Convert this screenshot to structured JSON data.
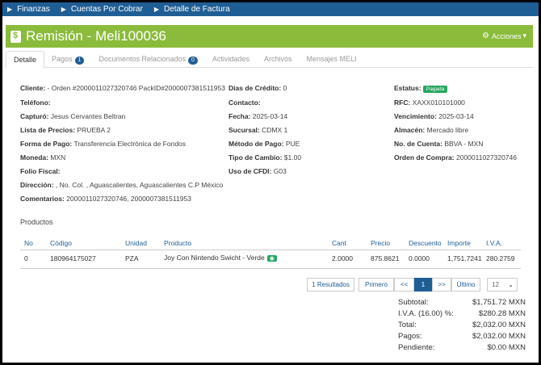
{
  "breadcrumbs": [
    "Finanzas",
    "Cuentas Por Cobrar",
    "Detalle de Factura"
  ],
  "header": {
    "title": "Remisión - Meli100036",
    "actions_label": "Acciones"
  },
  "tabs": [
    {
      "label": "Detalle",
      "badge": ""
    },
    {
      "label": "Pagos",
      "badge": "1"
    },
    {
      "label": "Documentos Relacionados",
      "badge": "0"
    },
    {
      "label": "Actividades",
      "badge": ""
    },
    {
      "label": "Archivos",
      "badge": ""
    },
    {
      "label": "Mensajes MELI",
      "badge": ""
    }
  ],
  "fields": {
    "cliente": {
      "k": "Cliente:",
      "v": " - Orden #2000011027320746 PackID#2000007381511953"
    },
    "telefono": {
      "k": "Teléfono:",
      "v": ""
    },
    "capturo": {
      "k": "Capturó:",
      "v": " Jesus Cervantes Beltran"
    },
    "lista": {
      "k": "Lista de Precios:",
      "v": " PRUEBA 2"
    },
    "forma": {
      "k": "Forma de Pago:",
      "v": " Transferencia Electrónica de Fondos"
    },
    "moneda": {
      "k": "Moneda:",
      "v": " MXN"
    },
    "folio": {
      "k": "Folio Fiscal:",
      "v": ""
    },
    "direccion": {
      "k": "Dirección:",
      "v": " , No. Col. , Aguascalientes, Aguascalientes C.P México"
    },
    "comentarios": {
      "k": "Comentarios:",
      "v": " 2000011027320746, 2000007381511953"
    },
    "dias": {
      "k": "Días de Crédito:",
      "v": " 0"
    },
    "contacto": {
      "k": "Contacto:",
      "v": ""
    },
    "fecha": {
      "k": "Fecha:",
      "v": " 2025-03-14"
    },
    "sucursal": {
      "k": "Sucursal:",
      "v": " CDMX 1"
    },
    "metodo": {
      "k": "Método de Pago:",
      "v": " PUE"
    },
    "tipo": {
      "k": "Tipo de Cambio:",
      "v": " $1.00"
    },
    "cfdi": {
      "k": "Uso de CFDI:",
      "v": " G03"
    },
    "estatus": {
      "k": "Estatus:",
      "v": "Pagada"
    },
    "rfc": {
      "k": "RFC:",
      "v": " XAXX010101000"
    },
    "vencimiento": {
      "k": "Vencimiento:",
      "v": " 2025-03-14"
    },
    "almacen": {
      "k": "Almacén:",
      "v": " Mercado libre"
    },
    "cuenta": {
      "k": "No. de Cuenta:",
      "v": " BBVA - MXN"
    },
    "orden": {
      "k": "Orden de Compra:",
      "v": " 2000011027320746"
    }
  },
  "products": {
    "title": "Productos",
    "headers": [
      "No",
      "Código",
      "Unidad",
      "Producto",
      "Cant",
      "Precio",
      "Descuento",
      "Importe",
      "I.V.A."
    ],
    "rows": [
      [
        "0",
        "180964175027",
        "PZA",
        "Joy Con Nintendo Swicht - Verde",
        "2.0000",
        "875.8621",
        "0.0000",
        "1,751.7241",
        "280.2759"
      ]
    ]
  },
  "pager": {
    "results": "1 Resultados",
    "first": "Primero",
    "prev": "<<",
    "current": "1",
    "next": ">>",
    "last": "Último",
    "page_size": "12"
  },
  "totals": [
    {
      "label": "Subtotal:",
      "value": "$1,751.72 MXN"
    },
    {
      "label": "I.V.A. (16.00) %:",
      "value": "$280.28 MXN"
    },
    {
      "label": "Total:",
      "value": "$2,032.00 MXN"
    },
    {
      "label": "Pagos:",
      "value": "$2,032.00 MXN"
    },
    {
      "label": "Pendiente:",
      "value": "$0.00 MXN"
    }
  ]
}
